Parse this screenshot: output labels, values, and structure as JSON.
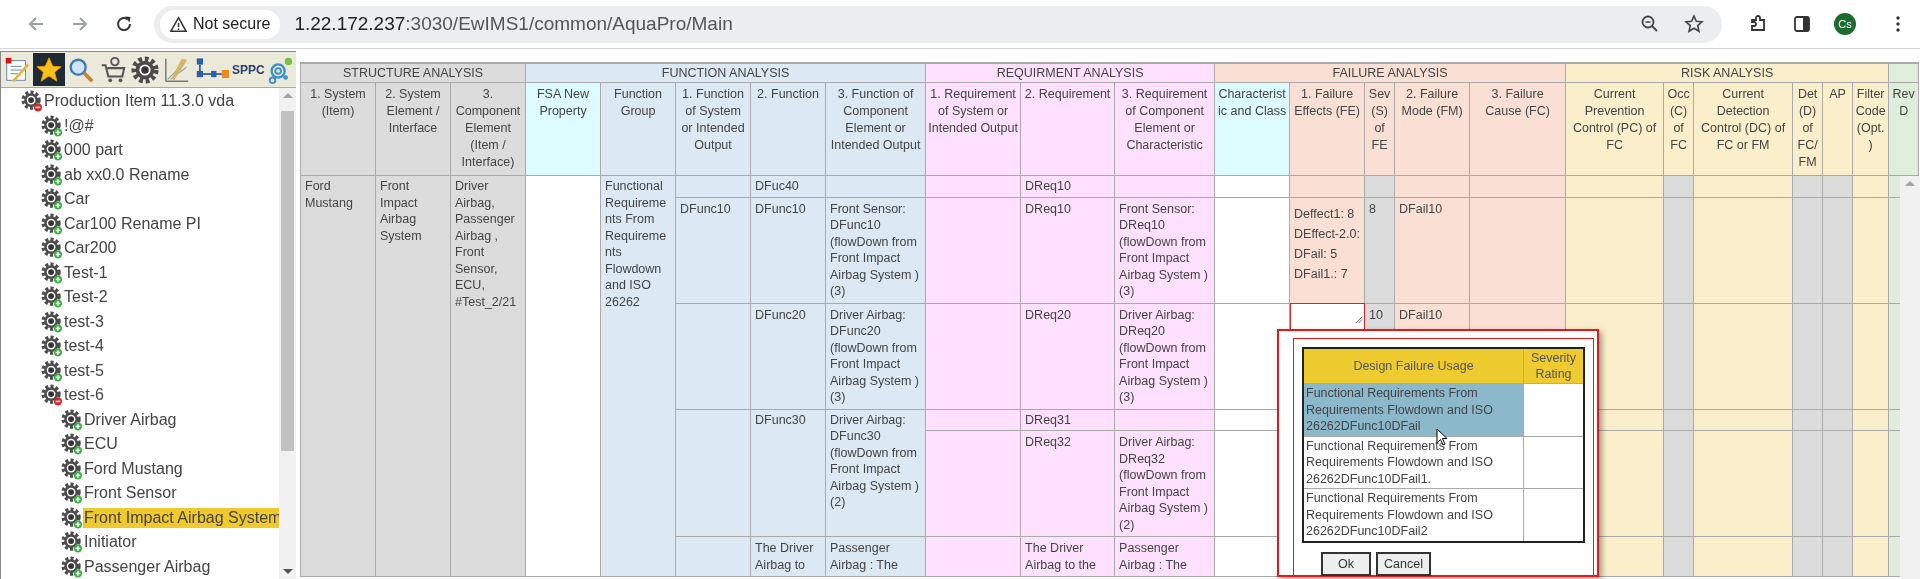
{
  "browser": {
    "security": "Not secure",
    "address": {
      "host": "1.22.172.237",
      "path": ":3030/EwIMS1/common/AquaPro/Main"
    },
    "profile": "Cs"
  },
  "toolbar": [
    {
      "kind": "notes",
      "selected": false
    },
    {
      "kind": "favorites",
      "selected": true
    },
    {
      "kind": "search",
      "selected": false
    },
    {
      "kind": "cart",
      "selected": false
    },
    {
      "kind": "gear",
      "selected": false
    },
    {
      "kind": "compass",
      "selected": false
    },
    {
      "kind": "flow",
      "selected": false
    },
    {
      "kind": "text",
      "label": "SPPC",
      "selected": false
    },
    {
      "kind": "circles",
      "selected": false
    }
  ],
  "tree": [
    {
      "label": "Production Item 11.3.0 vda",
      "expanded": true,
      "selected": false,
      "children": [
        {
          "label": "!@#",
          "expanded": false,
          "selected": false
        },
        {
          "label": "000 part",
          "expanded": false,
          "selected": false
        },
        {
          "label": "ab xx0.0 Rename",
          "expanded": false,
          "selected": false
        },
        {
          "label": "Car",
          "expanded": false,
          "selected": false
        },
        {
          "label": "Car100 Rename PI",
          "expanded": false,
          "selected": false
        },
        {
          "label": "Car200",
          "expanded": false,
          "selected": false
        },
        {
          "label": "Test-1",
          "expanded": false,
          "selected": false
        },
        {
          "label": "Test-2",
          "expanded": false,
          "selected": false
        },
        {
          "label": "test-3",
          "expanded": false,
          "selected": false
        },
        {
          "label": "test-4",
          "expanded": false,
          "selected": false
        },
        {
          "label": "test-5",
          "expanded": false,
          "selected": false
        },
        {
          "label": "test-6",
          "expanded": true,
          "selected": false,
          "children": [
            {
              "label": "Driver Airbag",
              "expanded": false,
              "selected": false
            },
            {
              "label": "ECU",
              "expanded": false,
              "selected": false
            },
            {
              "label": "Ford Mustang",
              "expanded": false,
              "selected": false
            },
            {
              "label": "Front Sensor",
              "expanded": false,
              "selected": false
            },
            {
              "label": "Front Impact Airbag System",
              "expanded": false,
              "selected": true
            },
            {
              "label": "Initiator",
              "expanded": false,
              "selected": false
            },
            {
              "label": "Passenger Airbag",
              "expanded": false,
              "selected": false
            }
          ]
        }
      ]
    }
  ],
  "table": {
    "groups": [
      {
        "label": "STRUCTURE ANALYSIS",
        "color": "#dcdcdc",
        "columns": [
          {
            "label": "1. System (Item)",
            "kind": "plain"
          },
          {
            "label": "2. System Element / Interface",
            "kind": "plain"
          },
          {
            "label": "3. Component Element (Item / Interface)",
            "kind": "plain"
          }
        ]
      },
      {
        "label": "FUNCTION ANALYSIS",
        "color": "#dce8f4",
        "columns": [
          {
            "label": "FSA New Property",
            "kind": "custom"
          },
          {
            "label": "Function Group",
            "kind": "plain"
          },
          {
            "label": "1. Function of System or Intended Output",
            "kind": "plain"
          },
          {
            "label": "2. Function",
            "kind": "plain"
          },
          {
            "label": "3. Function of Component Element or Intended Output",
            "kind": "plain"
          }
        ]
      },
      {
        "label": "REQUIRMENT ANALYSIS",
        "color": "#ffe0fe",
        "columns": [
          {
            "label": "1. Requirement of System or Intended Output",
            "kind": "plain"
          },
          {
            "label": "2. Requirement",
            "kind": "plain"
          },
          {
            "label": "3. Requirement of Component Element or Characteristic",
            "kind": "plain"
          }
        ]
      },
      {
        "label": "FAILURE ANALYSIS",
        "color": "#fae0d4",
        "columns": [
          {
            "label": "Characteristic and Class",
            "kind": "custom"
          },
          {
            "label": "1. Failure Effects (FE)",
            "kind": "plain"
          },
          {
            "label": "Sev (S) of FE",
            "kind": "rating"
          },
          {
            "label": "2. Failure Mode (FM)",
            "kind": "plain"
          },
          {
            "label": "3. Failure Cause (FC)",
            "kind": "plain"
          }
        ]
      },
      {
        "label": "RISK ANALYSIS",
        "color": "#fbeecb",
        "columns": [
          {
            "label": "Current Prevention Control (PC) of FC",
            "kind": "plain"
          },
          {
            "label": "Occ (C) of FC",
            "kind": "rating"
          },
          {
            "label": "Current Detection Control (DC) of FC or FM",
            "kind": "plain"
          },
          {
            "label": "Det (D) of FC/ FM",
            "kind": "rating"
          },
          {
            "label": "AP",
            "kind": "rating"
          },
          {
            "label": "Filter Code (Opt.)",
            "kind": "plain"
          }
        ]
      },
      {
        "color": "#dfeedb",
        "columns": [
          {
            "label": "Rev D",
            "kind": "plain"
          }
        ]
      }
    ],
    "record": {
      "system": "Ford Mustang",
      "element": "Front Impact Airbag System",
      "component": "Driver Airbag, Passenger Airbag , Front Sensor, ECU, #Test_2/21",
      "function_group": "Functional Requirements From Requirements Flowdown and ISO 26262",
      "functions": [
        {
          "function": "DFuc40",
          "requirements": [
            {
              "requirement": "DReq10",
              "editing": false
            }
          ]
        },
        {
          "system_function": "DFunc10",
          "function": "DFunc10",
          "element_function": "Front Sensor: DFunc10 (flowDown from Front Impact Airbag System ) (3)",
          "requirements": [
            {
              "requirement": "DReq10",
              "element_requirement": "Front Sensor: DReq10 (flowDown from Front Impact Airbag System ) (3)",
              "failure_effects": [
                "Deffect1: 8",
                "DEffect-2.0:",
                "DFail: 5",
                "DFail1.: 7"
              ],
              "severity": "8",
              "failure_mode": "DFail10",
              "editing": false
            }
          ]
        },
        {
          "function": "DFunc20",
          "element_function": "Driver Airbag: DFunc20 (flowDown from Front Impact Airbag System ) (3)",
          "requirements": [
            {
              "requirement": "DReq20",
              "element_requirement": "Driver Airbag: DReq20 (flowDown from Front Impact Airbag System ) (3)",
              "severity": "10",
              "failure_mode": "DFail10",
              "editing": true
            }
          ]
        },
        {
          "function": "DFunc30",
          "element_function": "Driver Airbag: DFunc30 (flowDown from Front Impact Airbag System ) (2)",
          "requirements": [
            {
              "requirement": "DReq31"
            },
            {
              "requirement": "DReq32",
              "element_requirement": "Driver Airbag: DReq32 (flowDown from Front Impact Airbag System ) (2)"
            }
          ]
        },
        {
          "function": "The Driver Airbag to",
          "element_function": "Passenger Airbag : The",
          "requirements": [
            {
              "requirement": "The Driver Airbag to the",
              "element_requirement": "Passenger Airbag : The"
            }
          ]
        }
      ]
    }
  },
  "popup": {
    "columns": [
      "Design Failure Usage",
      "Severity Rating"
    ],
    "rows": [
      {
        "usage": "Functional Requirements From Requirements Flowdown and ISO 26262DFunc10DFail",
        "selected": true
      },
      {
        "usage": "Functional Requirements From Requirements Flowdown and ISO 26262DFunc10DFail1.",
        "selected": false
      },
      {
        "usage": "Functional Requirements From Requirements Flowdown and ISO 26262DFunc10DFail2",
        "selected": false
      }
    ],
    "buttons": [
      "Ok",
      "Cancel"
    ]
  }
}
